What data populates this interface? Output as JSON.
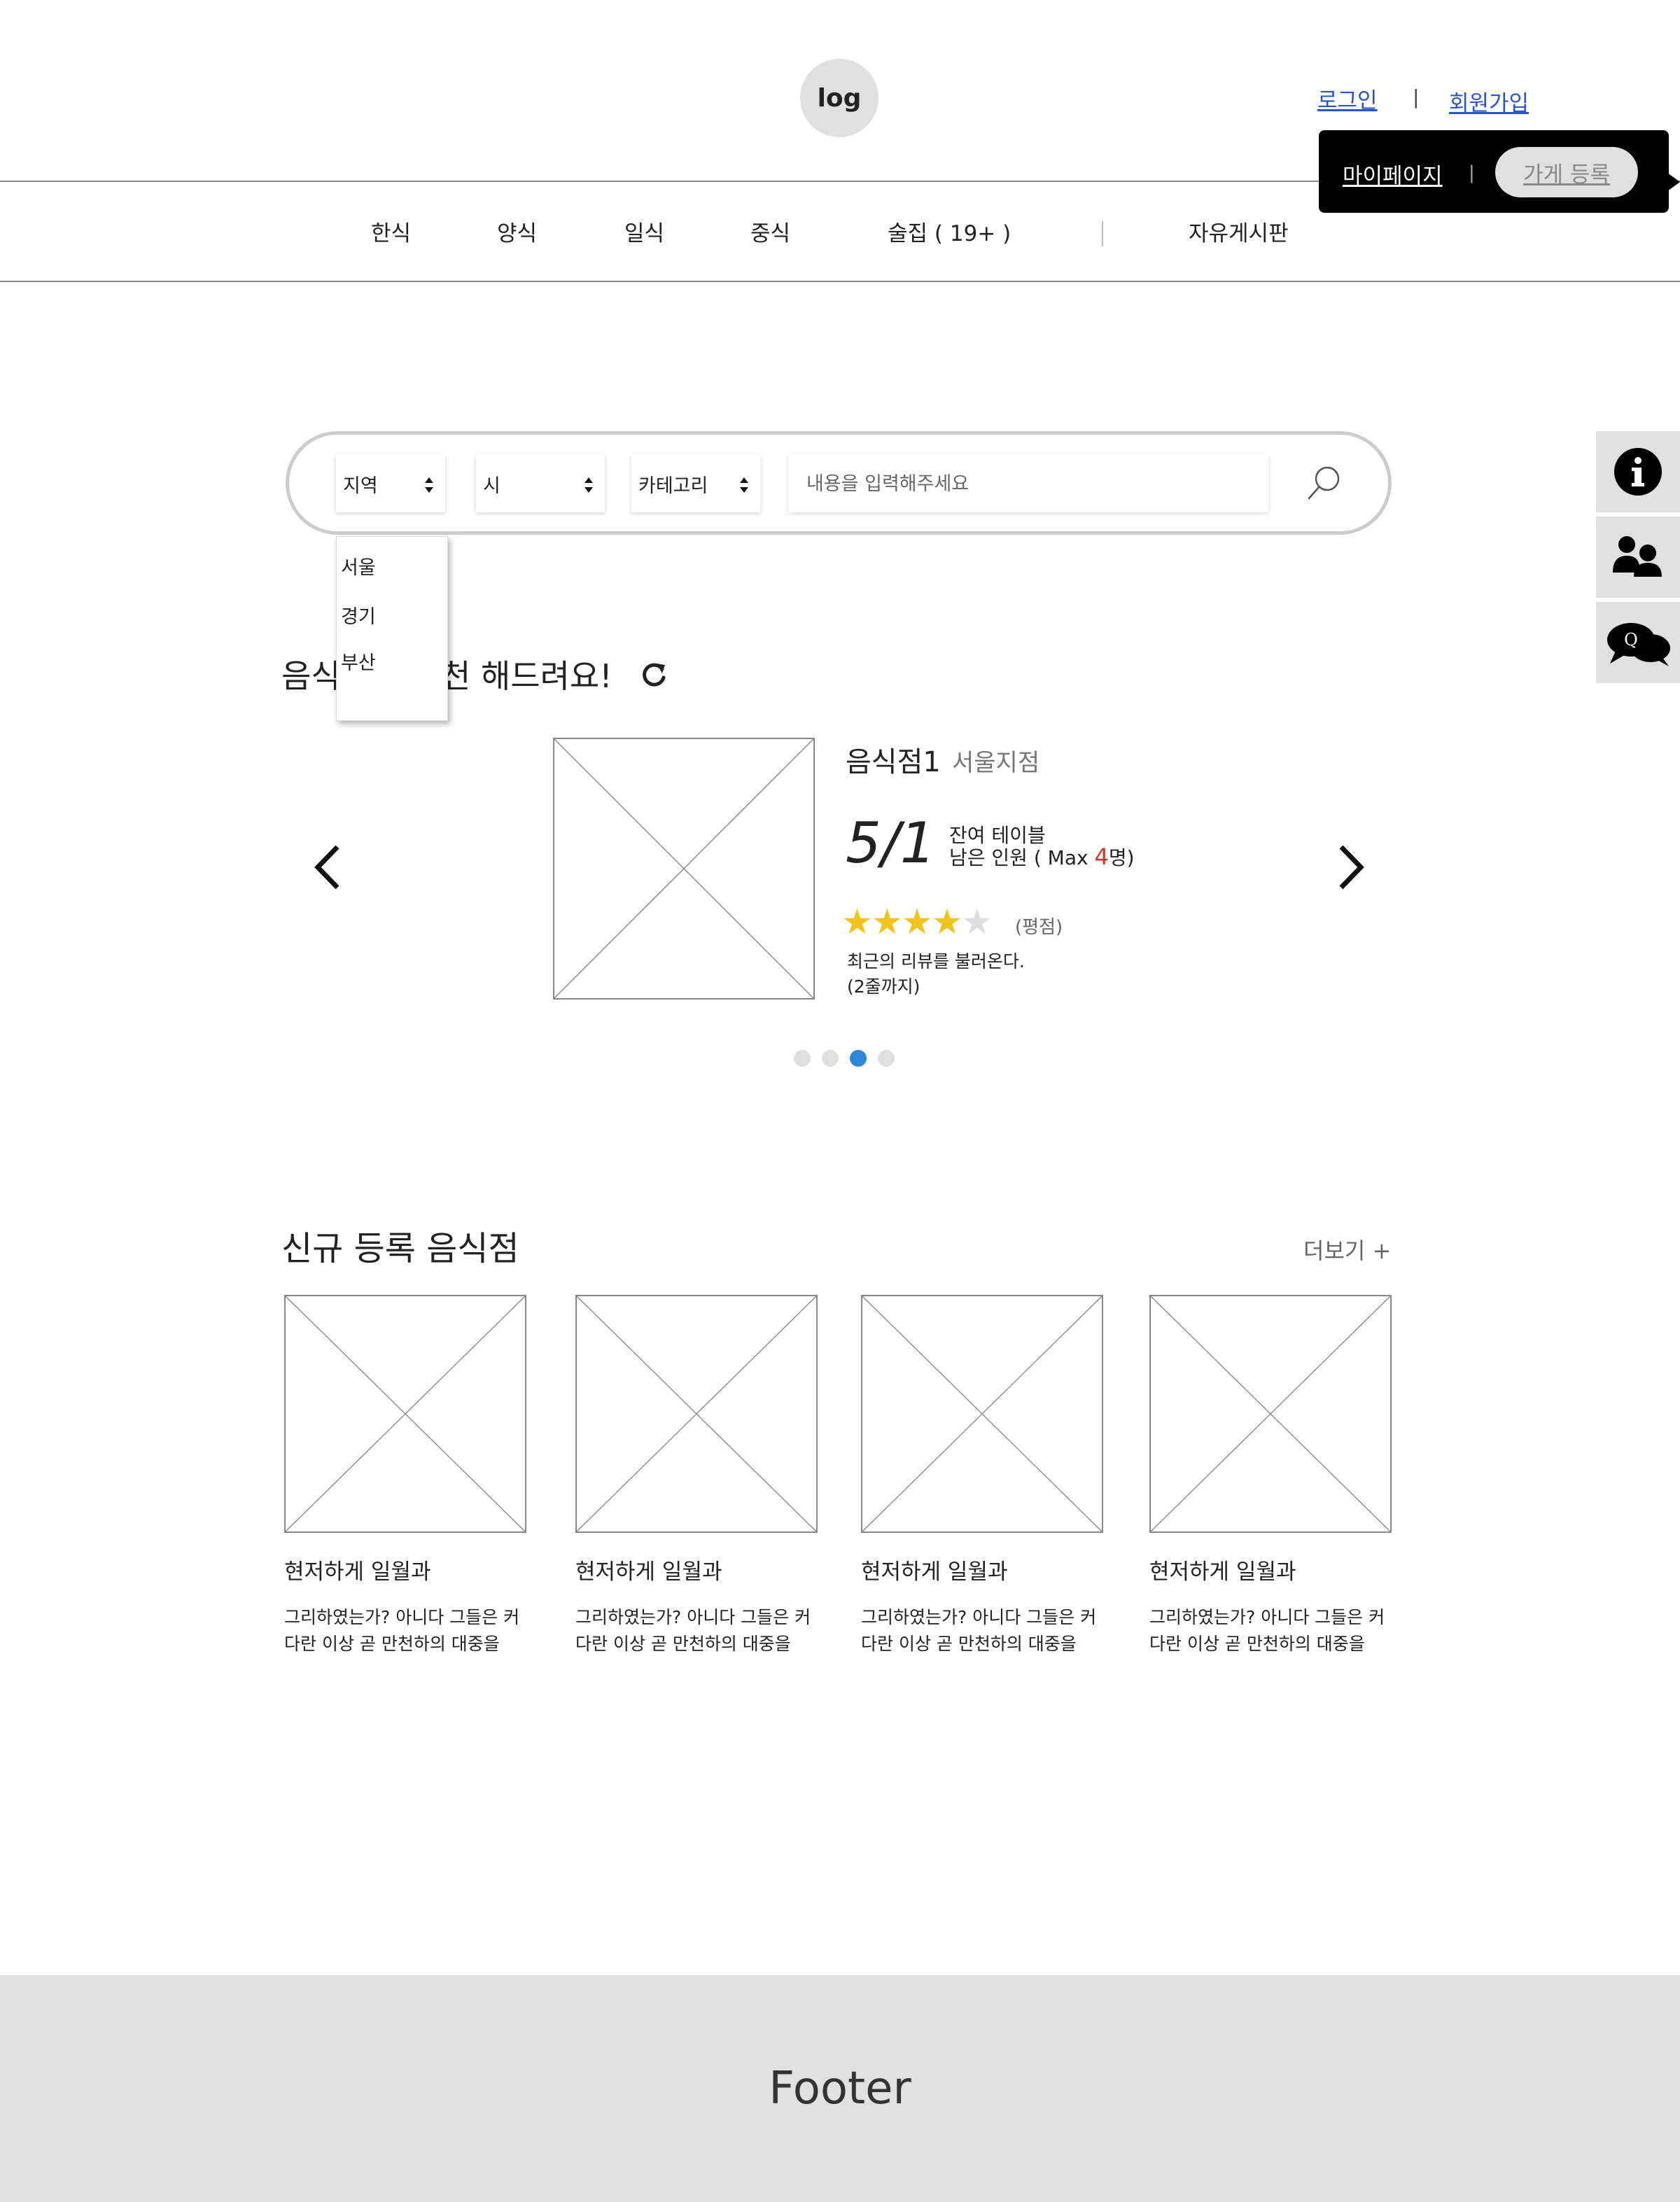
{
  "header": {
    "logo_text": "log",
    "login": "로그인",
    "separator": "|",
    "signup": "회원가입",
    "mypage": "마이페이지",
    "popup_separator": "|",
    "shop_register": "가게 등록"
  },
  "nav": {
    "items": [
      "한식",
      "양식",
      "일식",
      "중식",
      "술집 ( 19+ )"
    ],
    "board": "자유게시판"
  },
  "search": {
    "region_label": "지역",
    "city_label": "시",
    "category_label": "카테고리",
    "input_placeholder": "내용을 입력해주세요",
    "region_options": [
      "서울",
      "경기",
      "부산"
    ]
  },
  "side_menu": {
    "icons": [
      "info-icon",
      "users-icon",
      "qna-chat-icon"
    ]
  },
  "recommend": {
    "title_prefix": "음식",
    "title_suffix": "천 해드려요!",
    "store_name": "음식점1",
    "branch": "서울지점",
    "ratio": "5/1",
    "remaining_tables": "잔여 테이블",
    "remaining_people_prefix": "남은 인원 ( Max ",
    "remaining_people_max": "4",
    "remaining_people_suffix": "명)",
    "rating": 4,
    "rating_max": 5,
    "rating_label": "(평점)",
    "review_line1": "최근의 리뷰를 불러온다.",
    "review_line2": "(2줄까지)",
    "pager_count": 4,
    "pager_active_index": 2
  },
  "new_stores": {
    "title": "신규 등록 음식점",
    "more": "더보기 +",
    "cards": [
      {
        "title": "현저하게 일월과",
        "desc": "그리하였는가? 아니다 그들은 커다란 이상 곧 만천하의 대중을"
      },
      {
        "title": "현저하게 일월과",
        "desc": "그리하였는가? 아니다 그들은 커다란 이상 곧 만천하의 대중을"
      },
      {
        "title": "현저하게 일월과",
        "desc": "그리하였는가? 아니다 그들은 커다란 이상 곧 만천하의 대중을"
      },
      {
        "title": "현저하게 일월과",
        "desc": "그리하였는가? 아니다 그들은 커다란 이상 곧 만천하의 대중을"
      }
    ]
  },
  "footer": {
    "text": "Footer"
  },
  "colors": {
    "link": "#2a55c8",
    "star": "#f2c318",
    "active_dot": "#2d87d8",
    "accent_red": "#c0392b",
    "footer_bg": "#e0e0e0"
  }
}
